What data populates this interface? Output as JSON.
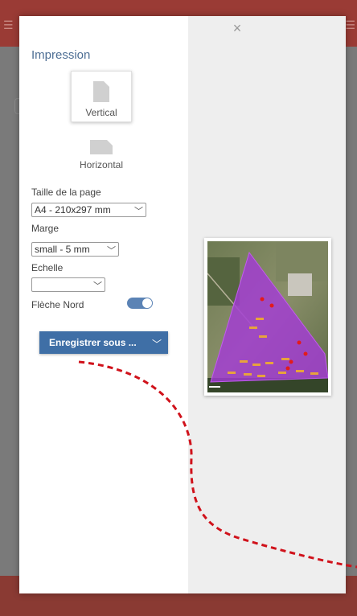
{
  "header": {
    "menu_icon": "menu-icon",
    "right_icon": "menu-icon"
  },
  "dialog": {
    "close_icon": "close-icon",
    "close_glyph": "×",
    "title": "Impression",
    "orientation": {
      "vertical_label": "Vertical",
      "horizontal_label": "Horizontal",
      "selected": "Vertical"
    },
    "page_size": {
      "label": "Taille de la page",
      "value": "A4 - 210x297 mm"
    },
    "margin": {
      "label": "Marge",
      "value": "small - 5 mm"
    },
    "scale": {
      "label": "Echelle",
      "value": ""
    },
    "north_arrow": {
      "label": "Flèche Nord",
      "enabled": true
    },
    "save_button": {
      "label": "Enregistrer sous ..."
    }
  },
  "colors": {
    "header": "#9a3b35",
    "title": "#4d6e94",
    "button": "#3f6fa6",
    "toggle": "#5b83b5",
    "field_polygon": "#a33bd6",
    "annotation": "#d0121b"
  }
}
